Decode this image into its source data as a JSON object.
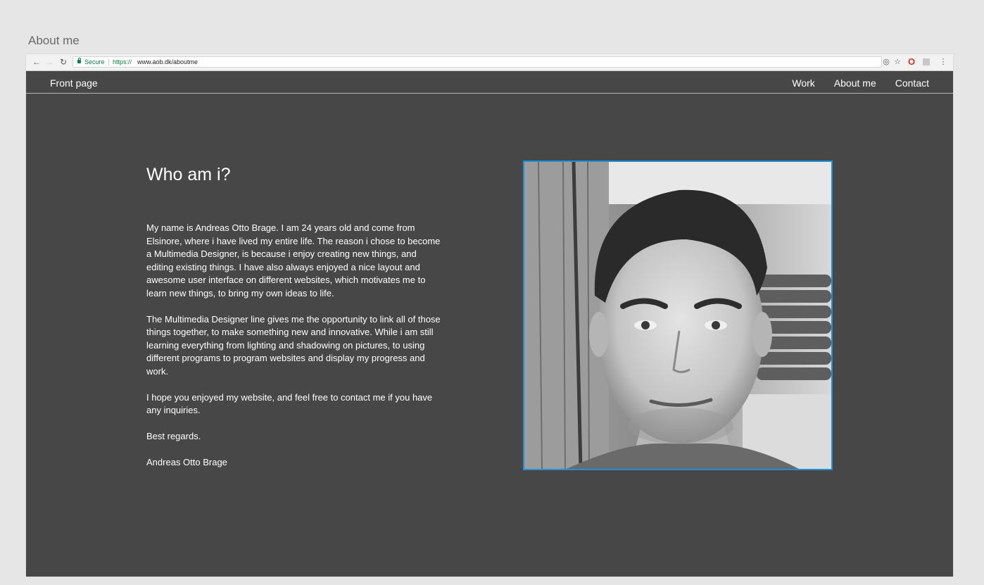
{
  "caption": "About me",
  "browser": {
    "secure_label": "Secure",
    "url_scheme": "https://",
    "url_host": "www.aob.dk/aboutme",
    "icons": [
      "back-arrow-icon",
      "forward-arrow-icon",
      "reload-icon",
      "lock-icon",
      "location-icon",
      "star-icon",
      "extension-icon",
      "extension-icon",
      "more-menu-icon"
    ]
  },
  "nav": {
    "front_page": "Front page",
    "items": [
      "Work",
      "About me",
      "Contact"
    ]
  },
  "content": {
    "heading": "Who am i?",
    "paragraphs": [
      "My name is Andreas Otto Brage. I am 24 years old and come from Elsinore, where i have lived my entire life. The reason i chose to become a Multimedia Designer, is because i enjoy creating new things, and editing existing things. I have also always enjoyed a nice layout and awesome user interface on different websites, which motivates me to learn new things, to bring my own ideas to life.",
      "The Multimedia Designer line gives me the opportunity to link all of those things together, to make something new and innovative. While i am still learning everything from lighting and shadowing on pictures, to using different programs to program websites and display my progress and work.",
      "I hope you enjoyed my website, and feel free to contact me if you have any inquiries.",
      "Best regards.",
      "Andreas Otto Brage"
    ]
  },
  "colors": {
    "page_background": "#e6e6e6",
    "site_background": "#474747",
    "photo_border": "#1f8fd6",
    "secure_green": "#0b8043"
  }
}
